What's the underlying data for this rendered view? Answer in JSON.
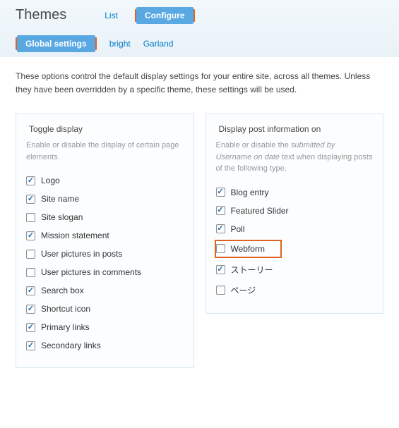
{
  "header": {
    "title": "Themes",
    "tabs": {
      "list": "List",
      "configure": "Configure"
    },
    "subtabs": {
      "global": "Global settings",
      "bright": "bright",
      "garland": "Garland"
    }
  },
  "intro": "These options control the default display settings for your entire site, across all themes. Unless they have been overridden by a specific theme, these settings will be used.",
  "toggle": {
    "legend": "Toggle display",
    "desc": "Enable or disable the display of certain page elements.",
    "items": {
      "logo": "Logo",
      "site_name": "Site name",
      "site_slogan": "Site slogan",
      "mission": "Mission statement",
      "user_pics_posts": "User pictures in posts",
      "user_pics_comments": "User pictures in comments",
      "search": "Search box",
      "shortcut": "Shortcut icon",
      "primary": "Primary links",
      "secondary": "Secondary links"
    }
  },
  "postinfo": {
    "legend": "Display post information on",
    "desc_pre": "Enable or disable the ",
    "desc_em": "submitted by Username on date",
    "desc_post": " text when displaying posts of the following type.",
    "items": {
      "blog": "Blog entry",
      "slider": "Featured Slider",
      "poll": "Poll",
      "webform": "Webform",
      "story": "ストーリー",
      "page": "ページ"
    }
  }
}
